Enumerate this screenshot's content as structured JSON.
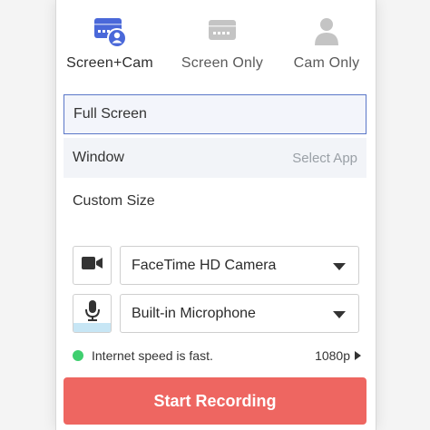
{
  "modes": [
    {
      "label": "Screen+Cam",
      "icon": "screen-cam-icon",
      "active": true
    },
    {
      "label": "Screen Only",
      "icon": "screen-icon",
      "active": false
    },
    {
      "label": "Cam Only",
      "icon": "person-icon",
      "active": false
    }
  ],
  "options": {
    "full": "Full Screen",
    "window": "Window",
    "window_action": "Select App",
    "custom": "Custom Size"
  },
  "camera": {
    "icon": "video-camera-icon",
    "selected": "FaceTime HD Camera"
  },
  "microphone": {
    "icon": "microphone-icon",
    "selected": "Built-in Microphone",
    "level": 0.25
  },
  "status": {
    "text": "Internet speed is fast.",
    "resolution": "1080p",
    "indicator_color": "#3fcf6f"
  },
  "cta": {
    "label": "Start Recording"
  },
  "colors": {
    "accent": "#4a68d9",
    "cta": "#ee6661",
    "selected_border": "#5a77c8"
  }
}
